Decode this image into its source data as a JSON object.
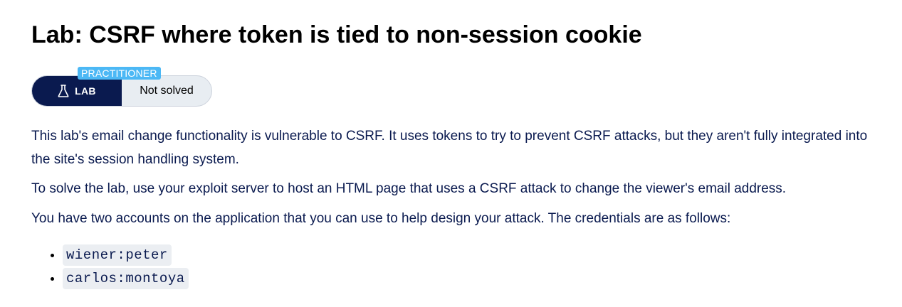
{
  "page": {
    "title": "Lab: CSRF where token is tied to non-session cookie"
  },
  "lab_badge": {
    "level": "PRACTITIONER",
    "type_label": "LAB",
    "type_icon": "flask-icon",
    "status": "Not solved",
    "colors": {
      "lab_bg": "#0a1a4f",
      "status_bg": "#e8edf2",
      "level_bg": "#4cb8f5"
    }
  },
  "description": {
    "paragraph_1": "This lab's email change functionality is vulnerable to CSRF. It uses tokens to try to prevent CSRF attacks, but they aren't fully integrated into the site's session handling system.",
    "paragraph_2": "To solve the lab, use your exploit server to host an HTML page that uses a CSRF attack to change the viewer's email address.",
    "paragraph_3": "You have two accounts on the application that you can use to help design your attack. The credentials are as follows:"
  },
  "credentials": [
    "wiener:peter",
    "carlos:montoya"
  ]
}
